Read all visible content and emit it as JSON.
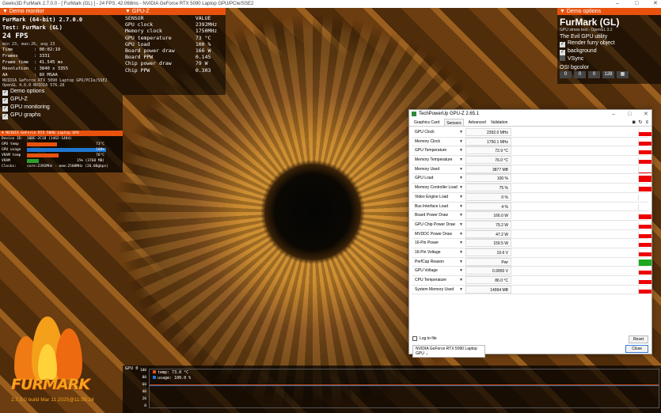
{
  "window": {
    "title": "Geeks3D FurMark 2.7.0.0 - [ FurMark (GL) ] - 24 FPS, 42.068ms - NVIDIA GeForce RTX 5090 Laptop GPU/PCIe/SSE2",
    "min": "–",
    "max": "□",
    "close": "✕"
  },
  "monitor": {
    "header": "▼ Demo monitor",
    "title": "FurMark (64-bit) 2.7.0.0",
    "test": "Test: FurMark (GL)",
    "fps": "24 FPS",
    "minmax": "min 23, max:26, avg 23",
    "stats": [
      {
        "k": "Time",
        "v": ": 00:02:19"
      },
      {
        "k": "Frames",
        "v": ": 3331"
      },
      {
        "k": "Frame time",
        "v": ": 41.545 ms"
      },
      {
        "k": "Resolution",
        "v": ": 3840 x 3355"
      },
      {
        "k": "AA",
        "v": ": 8X MSAA"
      }
    ],
    "gpu_line": "NVIDIA GeForce RTX 5090 Laptop GPU/PCIe/SSE2",
    "gl_line": "OpenGL 4.6.0 NVIDIA 576.28",
    "checks": [
      "Demo options",
      "GPU-Z",
      "GPU monitoring",
      "GPU graphs"
    ]
  },
  "gpumon": {
    "title": "▼ NVIDIA GeForce RTX 5090 Laptop GPU",
    "device": "Device ID:",
    "device_v": "10DE-2C18 (1462-1484)",
    "rows": [
      {
        "k": "GPU temp",
        "v": "73°C",
        "pct": 38,
        "c": "o"
      },
      {
        "k": "GPU usage",
        "v": "100%",
        "pct": 100,
        "c": "b"
      },
      {
        "k": "VRAM temp",
        "v": "76°C",
        "pct": 40,
        "c": "o"
      },
      {
        "k": "VRAM",
        "v": "15% (3768 MB)",
        "pct": 15,
        "c": "g"
      }
    ],
    "clocks": "Clocks:",
    "clocks_v": "core:2392MHz - mem:2500MHz (26.00gbps)"
  },
  "gpuz_panel": {
    "header": "▼ GPU-Z",
    "col1": "SENSOR",
    "col2": "VALUE",
    "rows": [
      [
        "GPU clock",
        "2392MHz"
      ],
      [
        "Memory clock",
        "1750MHz"
      ],
      [
        "GPU temperature",
        "73 °C"
      ],
      [
        "GPU load",
        "100 %"
      ],
      [
        "Board power draw",
        "166 W"
      ],
      [
        "Board PPW",
        "0.145"
      ],
      [
        "Chip power draw",
        "79 W"
      ],
      [
        "Chip PPW",
        "0.303"
      ]
    ]
  },
  "demo_options": {
    "header": "▼ Demo options",
    "title": "FurMark (GL)",
    "sub": "GPU stress test - OpenGL 3.2",
    "evil": "The Evil GPU utility",
    "checks": [
      {
        "label": "Render furry object",
        "on": "✓"
      },
      {
        "label": "background",
        "on": "✓"
      },
      {
        "label": "VSync",
        "on": ""
      }
    ],
    "bg_label": "OSI bgcolor",
    "bg_vals": [
      "0",
      "0",
      "0",
      "128"
    ]
  },
  "gpuz_window": {
    "title": "TechPowerUp GPU-Z 2.65.1",
    "tabs": [
      "Graphics Card",
      "Sensors",
      "Advanced",
      "Validation"
    ],
    "active_tab": "Sensors",
    "sensors": [
      {
        "name": "GPU Clock",
        "value": "2392.0 MHz",
        "fill": 0.6
      },
      {
        "name": "Memory Clock",
        "value": "1750.1 MHz",
        "fill": 0.6
      },
      {
        "name": "GPU Temperature",
        "value": "72.9 °C",
        "fill": 0.6
      },
      {
        "name": "Memory Temperature",
        "value": "76.0 °C",
        "fill": 0.6
      },
      {
        "name": "Memory Used",
        "value": "3877 MB",
        "fill": 0.15
      },
      {
        "name": "GPU Load",
        "value": "100 %",
        "fill": 1.0
      },
      {
        "name": "Memory Controller Load",
        "value": "75 %",
        "fill": 0.75
      },
      {
        "name": "Video Engine Load",
        "value": "0 %",
        "fill": 0
      },
      {
        "name": "Bus Interface Load",
        "value": "4 %",
        "fill": 0.05
      },
      {
        "name": "Board Power Draw",
        "value": "166.0 W",
        "fill": 0.7
      },
      {
        "name": "GPU Chip Power Draw",
        "value": "79.2 W",
        "fill": 0.6
      },
      {
        "name": "MVDDC Power Draw",
        "value": "47.2 W",
        "fill": 0.6
      },
      {
        "name": "16-Pin Power",
        "value": "159.5 W",
        "fill": 0.6
      },
      {
        "name": "16-Pin Voltage",
        "value": "19.6 V",
        "fill": 0.6
      },
      {
        "name": "PerfCap Reason",
        "value": "Pwr",
        "fill": 1.0,
        "color": "#1ea81e"
      },
      {
        "name": "GPU Voltage",
        "value": "0.9950 V",
        "fill": 0.6
      },
      {
        "name": "CPU Temperature",
        "value": "86.0 °C",
        "fill": 0.6
      },
      {
        "name": "System Memory Used",
        "value": "14994 MB",
        "fill": 0.6
      }
    ],
    "log": "Log to file",
    "reset": "Reset",
    "gpu_select": "NVIDIA GeForce RTX 5090 Laptop GPU",
    "close": "Close"
  },
  "graph": {
    "label": "GPU 0",
    "y": [
      "100",
      "80",
      "60",
      "40",
      "20",
      "0"
    ],
    "legend": [
      {
        "t": "temp: 73.0 °C",
        "c": "#e8520e"
      },
      {
        "t": "usage: 100.0 %",
        "c": "#1f77d0"
      }
    ]
  },
  "logo": {
    "word": "FURMARK",
    "version": "2.7.0.0 build Mar 11 2025@11:59:24"
  }
}
